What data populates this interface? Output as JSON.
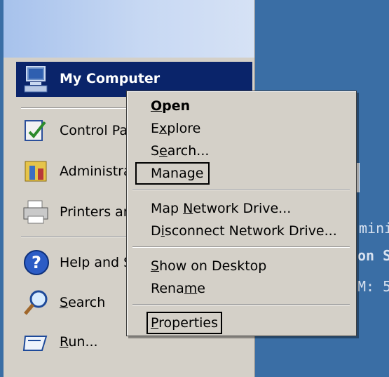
{
  "start_menu": {
    "pinned": {
      "label": "My Computer",
      "icon": "my-computer-icon"
    },
    "items": [
      {
        "label": "Control Pa",
        "icon": "control-panel-icon"
      },
      {
        "label": "Administra",
        "icon": "administrative-tools-icon"
      },
      {
        "label": "Printers ar",
        "icon": "printers-icon"
      },
      {
        "label": "Help and S",
        "icon": "help-icon"
      },
      {
        "label": "Search",
        "icon": "search-icon"
      },
      {
        "label": "Run...",
        "icon": "run-icon"
      }
    ]
  },
  "context_menu": {
    "items": [
      {
        "label": "Open",
        "bold": true
      },
      {
        "label": "Explore"
      },
      {
        "label": "Search..."
      },
      {
        "label": "Manage",
        "highlighted_box": true
      },
      {
        "label": "Map Network Drive..."
      },
      {
        "label": "Disconnect Network Drive..."
      },
      {
        "label": "Show on Desktop"
      },
      {
        "label": "Rename"
      },
      {
        "label": "Properties",
        "highlighted_box": true
      }
    ]
  },
  "desktop": {
    "text_fragments": [
      "mini",
      "on S",
      "M: 5"
    ]
  },
  "colors": {
    "desktop": "#3a6ea5",
    "menu_bg": "#d4d0c8",
    "selection": "#0a246a"
  }
}
